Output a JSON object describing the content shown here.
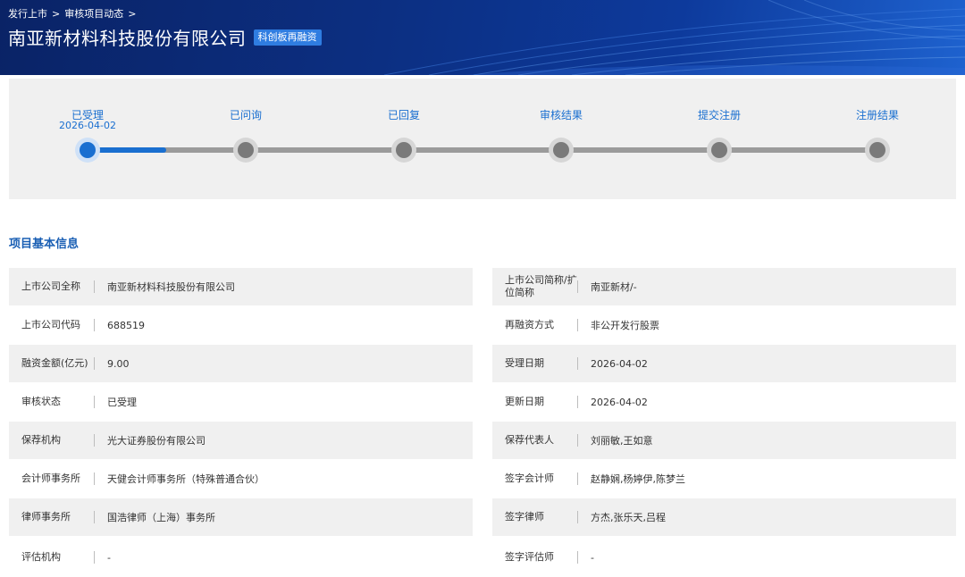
{
  "breadcrumb": {
    "items": [
      "发行上市",
      "审核项目动态"
    ],
    "separator": ">"
  },
  "header": {
    "company_name": "南亚新材料科技股份有限公司",
    "board_badge": "科创板再融资"
  },
  "progress": {
    "current_step": 0,
    "current_fill_fraction": 0.1,
    "steps": [
      {
        "label": "已受理",
        "date": "2026-04-02"
      },
      {
        "label": "已问询",
        "date": ""
      },
      {
        "label": "已回复",
        "date": ""
      },
      {
        "label": "审核结果",
        "date": ""
      },
      {
        "label": "提交注册",
        "date": ""
      },
      {
        "label": "注册结果",
        "date": ""
      }
    ]
  },
  "section": {
    "title": "项目基本信息"
  },
  "info": {
    "left": [
      {
        "label": "上市公司全称",
        "value": "南亚新材料科技股份有限公司"
      },
      {
        "label": "上市公司代码",
        "value": "688519"
      },
      {
        "label": "融资金额(亿元)",
        "value": "9.00"
      },
      {
        "label": "审核状态",
        "value": "已受理"
      },
      {
        "label": "保荐机构",
        "value": "光大证券股份有限公司"
      },
      {
        "label": "会计师事务所",
        "value": "天健会计师事务所（特殊普通合伙）"
      },
      {
        "label": "律师事务所",
        "value": "国浩律师（上海）事务所"
      },
      {
        "label": "评估机构",
        "value": "-"
      }
    ],
    "right": [
      {
        "label": "上市公司简称/扩位简称",
        "value": "南亚新材/-"
      },
      {
        "label": "再融资方式",
        "value": "非公开发行股票"
      },
      {
        "label": "受理日期",
        "value": "2026-04-02"
      },
      {
        "label": "更新日期",
        "value": "2026-04-02"
      },
      {
        "label": "保荐代表人",
        "value": "刘丽敏,王如意"
      },
      {
        "label": "签字会计师",
        "value": "赵静娴,杨婷伊,陈梦兰"
      },
      {
        "label": "签字律师",
        "value": "方杰,张乐天,吕程"
      },
      {
        "label": "签字评估师",
        "value": "-"
      }
    ]
  },
  "colors": {
    "banner": "#0c2f82",
    "accent": "#1a6fd0",
    "badge": "#2f7de1",
    "row_bg": "#f0f0f0"
  }
}
